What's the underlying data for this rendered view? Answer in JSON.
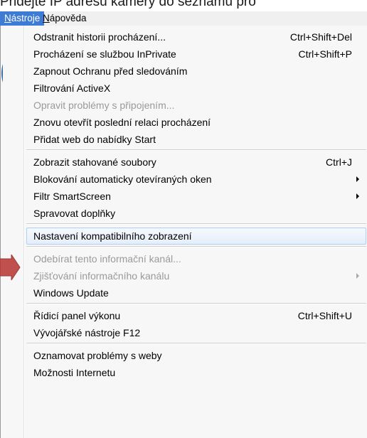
{
  "background": {
    "heading": "Přidejte IP adresu kamery do seznamu pro"
  },
  "menubar": {
    "items": [
      {
        "mnemonic": "N",
        "rest": "ástroje",
        "mnemonic_after": false,
        "active": true
      },
      {
        "mnemonic": "N",
        "rest": "ápověda",
        "mnemonic_after": false,
        "active": false
      }
    ]
  },
  "menu": {
    "items": [
      {
        "label": "Odstranit historii procházení...",
        "shortcut": "Ctrl+Shift+Del",
        "submenu": false,
        "disabled": false,
        "highlighted": false
      },
      {
        "label": "Procházení se službou InPrivate",
        "shortcut": "Ctrl+Shift+P",
        "submenu": false,
        "disabled": false,
        "highlighted": false
      },
      {
        "label": "Zapnout Ochranu před sledováním",
        "shortcut": "",
        "submenu": false,
        "disabled": false,
        "highlighted": false
      },
      {
        "label": "Filtrování ActiveX",
        "shortcut": "",
        "submenu": false,
        "disabled": false,
        "highlighted": false
      },
      {
        "label": "Opravit problémy s připojením...",
        "shortcut": "",
        "submenu": false,
        "disabled": true,
        "highlighted": false
      },
      {
        "label": "Znovu otevřít poslední relaci procházení",
        "shortcut": "",
        "submenu": false,
        "disabled": false,
        "highlighted": false
      },
      {
        "label": "Přidat web do nabídky Start",
        "shortcut": "",
        "submenu": false,
        "disabled": false,
        "highlighted": false
      },
      {
        "label": "Zobrazit stahované soubory",
        "shortcut": "Ctrl+J",
        "submenu": false,
        "disabled": false,
        "highlighted": false
      },
      {
        "label": "Blokování automaticky otevíraných oken",
        "shortcut": "",
        "submenu": true,
        "disabled": false,
        "highlighted": false
      },
      {
        "label": "Filtr SmartScreen",
        "shortcut": "",
        "submenu": true,
        "disabled": false,
        "highlighted": false
      },
      {
        "label": "Spravovat doplňky",
        "shortcut": "",
        "submenu": false,
        "disabled": false,
        "highlighted": false
      },
      {
        "label": "Nastavení kompatibilního zobrazení",
        "shortcut": "",
        "submenu": false,
        "disabled": false,
        "highlighted": true
      },
      {
        "label": "Odebírat tento informační kanál...",
        "shortcut": "",
        "submenu": false,
        "disabled": true,
        "highlighted": false
      },
      {
        "label": "Zjišťování informačního kanálu",
        "shortcut": "",
        "submenu": true,
        "disabled": true,
        "highlighted": false
      },
      {
        "label": "Windows Update",
        "shortcut": "",
        "submenu": false,
        "disabled": false,
        "highlighted": false
      },
      {
        "label": "Řídicí panel výkonu",
        "shortcut": "Ctrl+Shift+U",
        "submenu": false,
        "disabled": false,
        "highlighted": false
      },
      {
        "label": "Vývojářské nástroje F12",
        "shortcut": "",
        "submenu": false,
        "disabled": false,
        "highlighted": false
      },
      {
        "label": "Oznamovat problémy s weby",
        "shortcut": "",
        "submenu": false,
        "disabled": false,
        "highlighted": false
      },
      {
        "label": "Možnosti Internetu",
        "shortcut": "",
        "submenu": false,
        "disabled": false,
        "highlighted": false
      }
    ]
  },
  "colors": {
    "menubar_active": "#3d7bd4",
    "disabled_text": "#9a9a9a",
    "highlight_border": "#aecff7",
    "pointer_fill": "#c0504d"
  },
  "icons": {
    "pointer": "arrow-pointer-icon",
    "submenu": "chevron-right-icon"
  }
}
